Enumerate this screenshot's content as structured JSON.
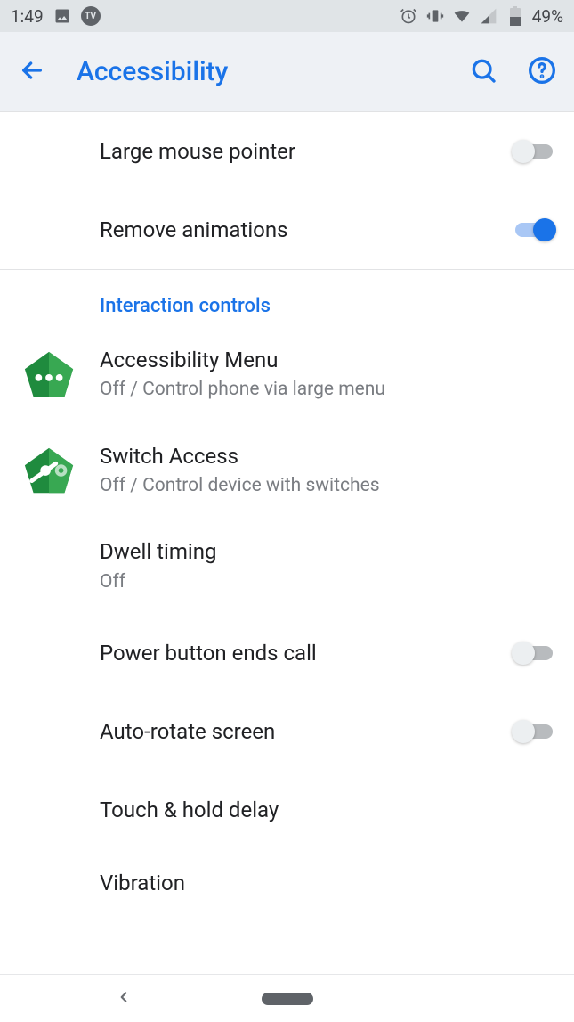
{
  "statusbar": {
    "time": "1:49",
    "battery_text": "49%"
  },
  "appbar": {
    "title": "Accessibility"
  },
  "settings": {
    "large_mouse_pointer": {
      "title": "Large mouse pointer"
    },
    "remove_animations": {
      "title": "Remove animations"
    },
    "section_interaction": "Interaction controls",
    "accessibility_menu": {
      "title": "Accessibility Menu",
      "sub": "Off / Control phone via large menu"
    },
    "switch_access": {
      "title": "Switch Access",
      "sub": "Off / Control device with switches"
    },
    "dwell_timing": {
      "title": "Dwell timing",
      "sub": "Off"
    },
    "power_button_ends_call": {
      "title": "Power button ends call"
    },
    "auto_rotate": {
      "title": "Auto-rotate screen"
    },
    "touch_hold_delay": {
      "title": "Touch & hold delay"
    },
    "vibration": {
      "title": "Vibration"
    }
  }
}
